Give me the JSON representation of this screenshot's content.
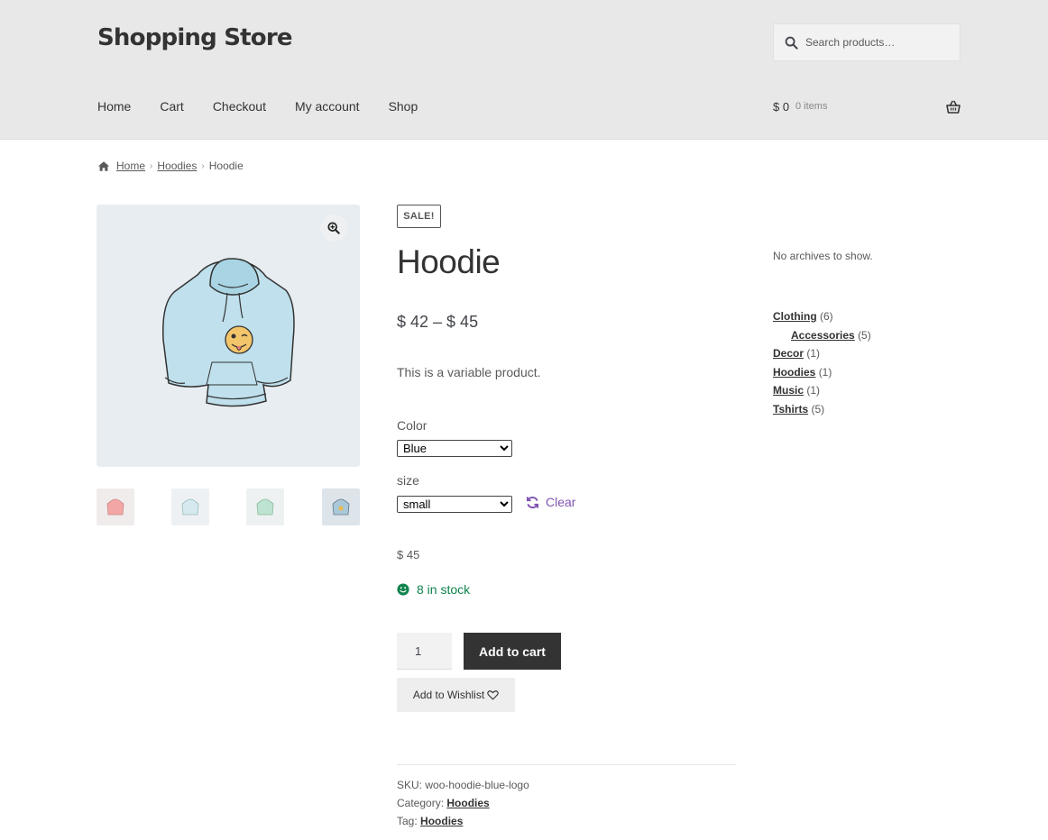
{
  "site": {
    "title": "Shopping Store"
  },
  "search": {
    "placeholder": "Search products…",
    "icon": "search-icon"
  },
  "nav": {
    "items": [
      "Home",
      "Cart",
      "Checkout",
      "My account",
      "Shop"
    ]
  },
  "cart": {
    "amount": "$ 0",
    "items": "0 items",
    "icon": "basket-icon"
  },
  "breadcrumb": {
    "home": "Home",
    "category": "Hoodies",
    "current": "Hoodie"
  },
  "product": {
    "sale_badge": "SALE!",
    "title": "Hoodie",
    "price_range": "$ 42 – $ 45",
    "description": "This is a variable product.",
    "color_label": "Color",
    "color_options": [
      "Blue"
    ],
    "size_label": "size",
    "size_options": [
      "small"
    ],
    "clear_label": "Clear",
    "variation_price": "$ 45",
    "stock": "8 in stock",
    "quantity": "1",
    "add_to_cart": "Add to cart",
    "wishlist": "Add to Wishlist",
    "sku_label": "SKU:",
    "sku": "woo-hoodie-blue-logo",
    "category_label": "Category:",
    "category": "Hoodies",
    "tag_label": "Tag:",
    "tag": "Hoodies"
  },
  "sidebar": {
    "archives": "No archives to show.",
    "categories": [
      {
        "name": "Clothing",
        "count": "(6)",
        "child": false
      },
      {
        "name": "Accessories",
        "count": "(5)",
        "child": true
      },
      {
        "name": "Decor",
        "count": "(1)",
        "child": false
      },
      {
        "name": "Hoodies",
        "count": "(1)",
        "child": false
      },
      {
        "name": "Music",
        "count": "(1)",
        "child": false
      },
      {
        "name": "Tshirts",
        "count": "(5)",
        "child": false
      }
    ]
  },
  "colors": {
    "accent": "#7f54b3",
    "stock": "#0f834d",
    "dark_button": "#333333",
    "header_bg": "#e8e8e8"
  }
}
